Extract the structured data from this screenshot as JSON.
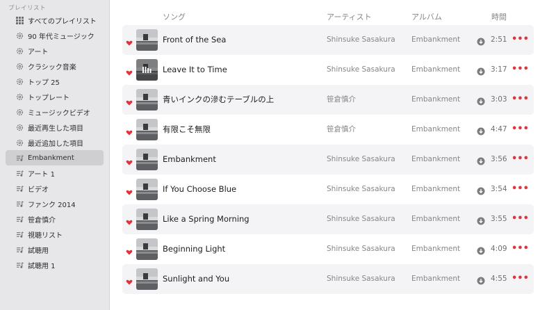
{
  "sidebar": {
    "heading": "プレイリスト",
    "items": [
      {
        "label": "すべてのプレイリスト",
        "icon": "grid-icon"
      },
      {
        "label": "90 年代ミュージック",
        "icon": "gear-icon"
      },
      {
        "label": "アート",
        "icon": "gear-icon"
      },
      {
        "label": "クラシック音楽",
        "icon": "gear-icon"
      },
      {
        "label": "トップ 25",
        "icon": "gear-icon"
      },
      {
        "label": "トップレート",
        "icon": "gear-icon"
      },
      {
        "label": "ミュージックビデオ",
        "icon": "gear-icon"
      },
      {
        "label": "最近再生した項目",
        "icon": "gear-icon"
      },
      {
        "label": "最近追加した項目",
        "icon": "gear-icon"
      },
      {
        "label": "Embankment",
        "icon": "playlist-icon",
        "selected": true
      },
      {
        "label": "アート 1",
        "icon": "playlist-icon"
      },
      {
        "label": "ビデオ",
        "icon": "playlist-icon"
      },
      {
        "label": "ファンク 2014",
        "icon": "playlist-icon"
      },
      {
        "label": "笹倉慎介",
        "icon": "playlist-icon"
      },
      {
        "label": "視聴リスト",
        "icon": "playlist-icon"
      },
      {
        "label": "試聴用",
        "icon": "playlist-icon"
      },
      {
        "label": "試聴用 1",
        "icon": "playlist-icon"
      }
    ]
  },
  "columns": {
    "song": "ソング",
    "artist": "アーティスト",
    "album": "アルバム",
    "time": "時間"
  },
  "songs": [
    {
      "title": "Front of the Sea",
      "artist": "Shinsuke Sasakura",
      "album": "Embankment",
      "time": "2:51",
      "more": "•••"
    },
    {
      "title": "Leave It to Time",
      "artist": "Shinsuke Sasakura",
      "album": "Embankment",
      "time": "3:17",
      "more": "•••"
    },
    {
      "title": "青いインクの滲むテーブルの上",
      "artist": "笹倉慎介",
      "album": "Embankment",
      "time": "3:03",
      "more": "•••"
    },
    {
      "title": "有限こそ無限",
      "artist": "笹倉慎介",
      "album": "Embankment",
      "time": "4:47",
      "more": "•••"
    },
    {
      "title": "Embankment",
      "artist": "Shinsuke Sasakura",
      "album": "Embankment",
      "time": "3:56",
      "more": "•••"
    },
    {
      "title": "If You Choose Blue",
      "artist": "Shinsuke Sasakura",
      "album": "Embankment",
      "time": "3:54",
      "more": "•••"
    },
    {
      "title": "Like a Spring Morning",
      "artist": "Shinsuke Sasakura",
      "album": "Embankment",
      "time": "3:55",
      "more": "•••"
    },
    {
      "title": "Beginning Light",
      "artist": "Shinsuke Sasakura",
      "album": "Embankment",
      "time": "4:09",
      "more": "•••"
    },
    {
      "title": "Sunlight and You",
      "artist": "Shinsuke Sasakura",
      "album": "Embankment",
      "time": "4:55",
      "more": "•••"
    }
  ],
  "colors": {
    "accent": "#e0343d",
    "sidebar_bg": "#e7e6e8",
    "row_alt": "#f4f4f6"
  }
}
